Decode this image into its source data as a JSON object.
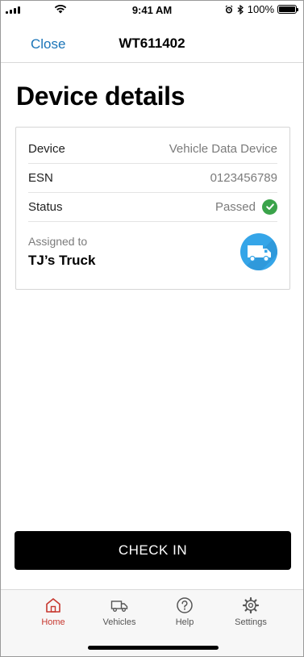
{
  "status_bar": {
    "time": "9:41 AM",
    "battery": "100%"
  },
  "nav": {
    "close_label": "Close",
    "title": "WT611402"
  },
  "page": {
    "title": "Device details"
  },
  "device": {
    "rows": [
      {
        "label": "Device",
        "value": "Vehicle Data Device"
      },
      {
        "label": "ESN",
        "value": "0123456789"
      },
      {
        "label": "Status",
        "value": "Passed"
      }
    ],
    "assigned_label": "Assigned to",
    "assigned_value": "TJ’s Truck",
    "status_color": "#3aa34a",
    "avatar_color": "#35a5e8"
  },
  "actions": {
    "check_in_label": "CHECK IN"
  },
  "tabs": [
    {
      "label": "Home",
      "icon": "home-icon",
      "active": true
    },
    {
      "label": "Vehicles",
      "icon": "truck-icon",
      "active": false
    },
    {
      "label": "Help",
      "icon": "help-icon",
      "active": false
    },
    {
      "label": "Settings",
      "icon": "gear-icon",
      "active": false
    }
  ],
  "colors": {
    "accent_link": "#1a74b8",
    "active_tab": "#c7372f"
  }
}
